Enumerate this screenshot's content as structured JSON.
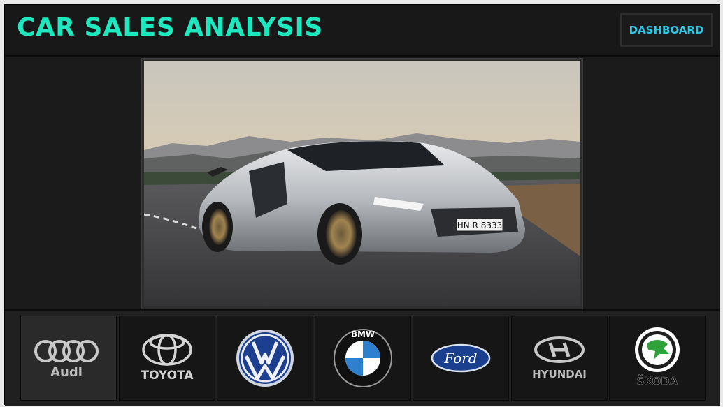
{
  "header": {
    "title": "CAR SALES ANALYSIS",
    "dashboard_label": "DASHBOARD"
  },
  "hero": {
    "plate": "HN·R 8333"
  },
  "brands": [
    {
      "name": "Audi",
      "wordmark": "Audi",
      "icon": "audi-logo-icon"
    },
    {
      "name": "Toyota",
      "wordmark": "TOYOTA",
      "icon": "toyota-logo-icon"
    },
    {
      "name": "Volkswagen",
      "icon": "volkswagen-logo-icon"
    },
    {
      "name": "BMW",
      "wordmark": "BMW",
      "icon": "bmw-logo-icon"
    },
    {
      "name": "Ford",
      "wordmark": "Ford",
      "icon": "ford-logo-icon"
    },
    {
      "name": "Hyundai",
      "wordmark": "HYUNDAI",
      "icon": "hyundai-logo-icon"
    },
    {
      "name": "Skoda",
      "wordmark": "ŠKODA",
      "icon": "skoda-logo-icon"
    }
  ],
  "colors": {
    "title": "#1ee8c0",
    "dashboard_text": "#2bc8e6",
    "panel_bg": "#1b1b1b"
  }
}
